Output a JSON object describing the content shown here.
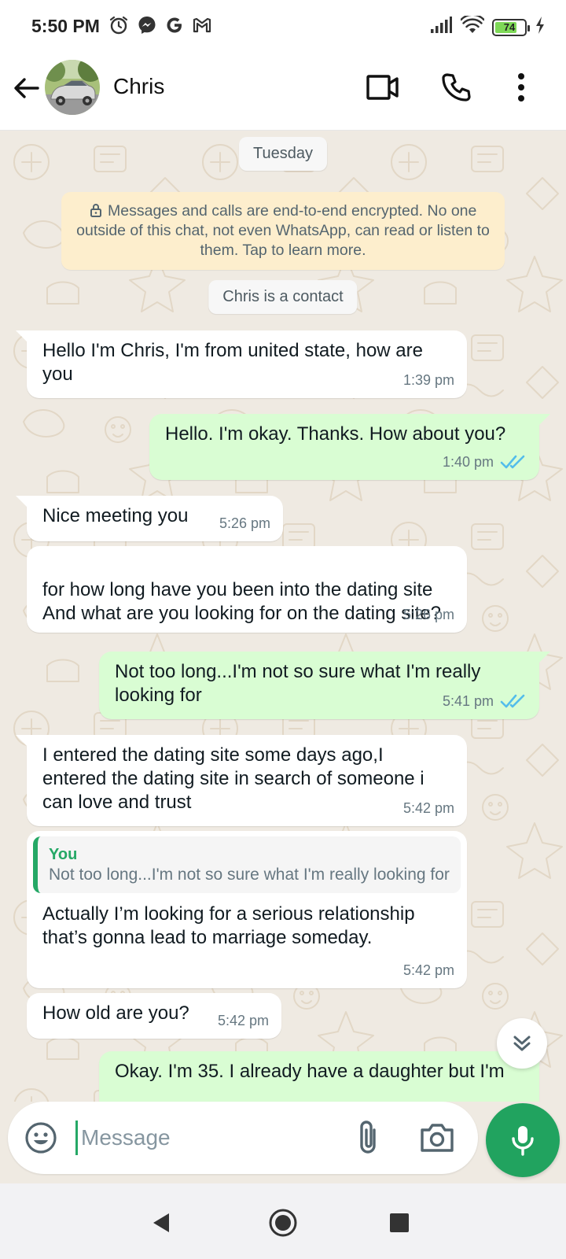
{
  "status_bar": {
    "time": "5:50 PM",
    "battery": "74",
    "battery_fraction": 0.74,
    "icons": [
      "alarm-icon",
      "messenger-icon",
      "google-icon",
      "gmail-icon",
      "signal-icon",
      "wifi-icon",
      "battery-icon",
      "charging-icon"
    ]
  },
  "header": {
    "contact_name": "Chris",
    "icons": [
      "back-arrow-icon",
      "video-call-icon",
      "voice-call-icon",
      "more-vert-icon"
    ]
  },
  "chat": {
    "date_label": "Tuesday",
    "encryption_notice": "Messages and calls are end-to-end encrypted. No one outside of this chat, not even WhatsApp, can read or listen to them. Tap to learn more.",
    "contact_notice": "Chris is a contact",
    "messages": [
      {
        "direction": "in",
        "text": "Hello I'm Chris, I'm from united state, how are you",
        "time": "1:39 pm"
      },
      {
        "direction": "out",
        "text": "Hello. I'm okay. Thanks. How about you?",
        "time": "1:40 pm",
        "status": "read"
      },
      {
        "direction": "in",
        "text": "Nice meeting you",
        "time": "5:26 pm"
      },
      {
        "direction": "in",
        "text": "for how long have you been into the dating site\nAnd what are you looking for on the dating site?",
        "time": "5:26 pm"
      },
      {
        "direction": "out",
        "text": "Not too long...I'm not so sure what I'm really looking for",
        "time": "5:41 pm",
        "status": "read"
      },
      {
        "direction": "in",
        "text": "I entered the dating site some days ago,I entered the dating site in search of someone i can love and trust",
        "time": "5:42 pm"
      },
      {
        "direction": "in",
        "quote_author": "You",
        "quote_text": "Not too long...I'm not so sure what I'm really looking for",
        "text": "Actually I’m looking for a serious relationship that’s gonna lead to marriage someday.",
        "time": "5:42 pm"
      },
      {
        "direction": "in",
        "text": "How old are you?",
        "time": "5:42 pm"
      },
      {
        "direction": "out",
        "text": "Okay. I'm 35. I already have a daughter but I'm",
        "partial": true
      }
    ]
  },
  "input": {
    "placeholder": "Message",
    "icons": [
      "emoji-icon",
      "attach-icon",
      "camera-icon",
      "mic-icon"
    ]
  },
  "colors": {
    "accent": "#21a35f",
    "outgoing_bubble": "#d9fdd3",
    "incoming_bubble": "#ffffff",
    "chat_background": "#efeae2",
    "read_ticks": "#53bdeb",
    "encryption_bg": "#fdeecd"
  }
}
